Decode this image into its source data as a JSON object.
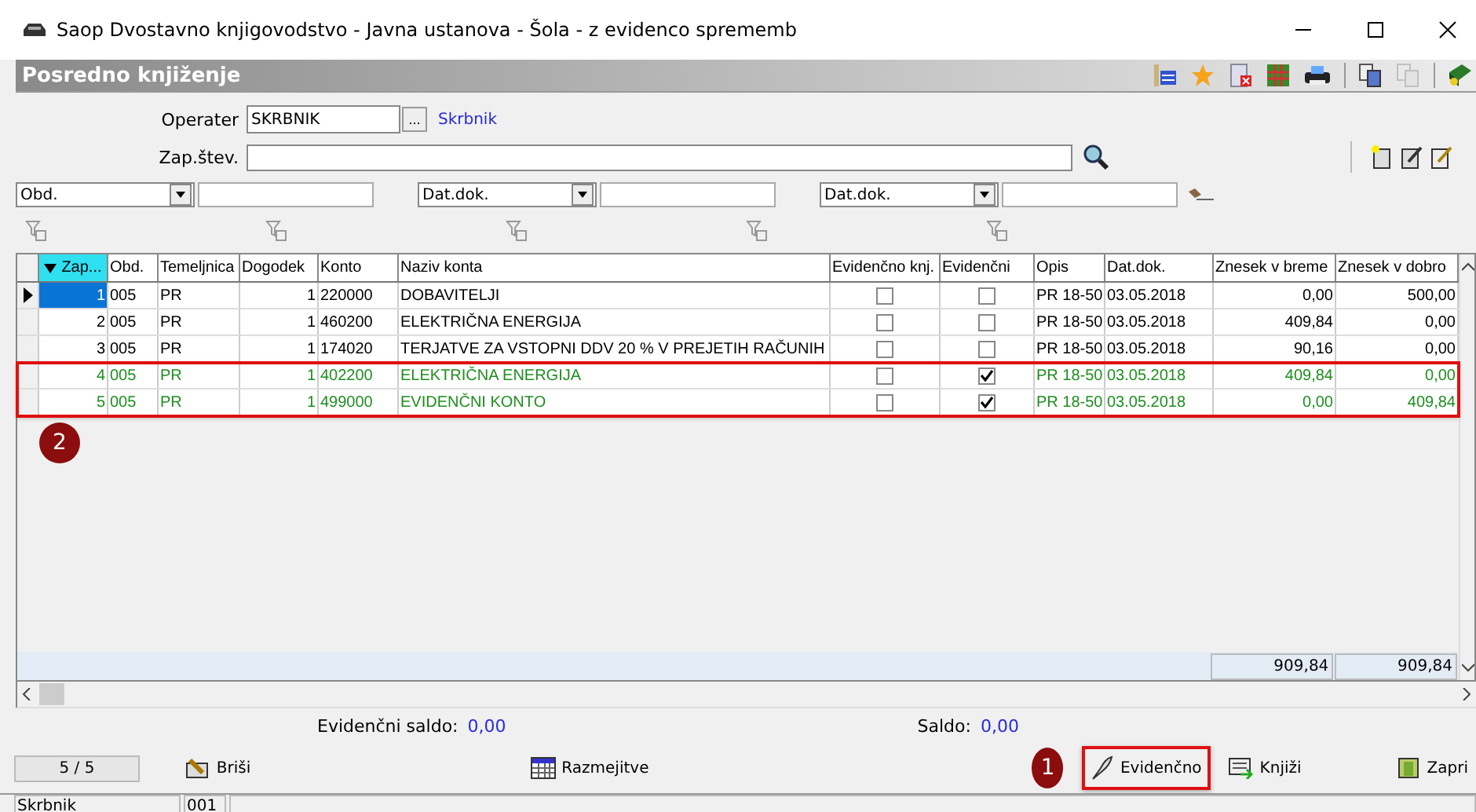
{
  "window": {
    "title": "Saop Dvostavno knjigovodstvo - Javna ustanova - Šola - z evidenco sprememb"
  },
  "panel": {
    "title": "Posredno knjiženje"
  },
  "form": {
    "operater": {
      "label": "Operater",
      "value": "SKRBNIK",
      "browse": "...",
      "name": "Skrbnik"
    },
    "zap_stev": {
      "label": "Zap.štev."
    }
  },
  "filters": [
    {
      "field": "Obd."
    },
    {
      "field": "Dat.dok."
    },
    {
      "field": "Dat.dok."
    }
  ],
  "table": {
    "columns": [
      "Zap...",
      "Obd.",
      "Temeljnica",
      "Dogodek",
      "Konto",
      "Naziv konta",
      "Evidenčno knj.",
      "Evidenčni",
      "Opis",
      "Dat.dok.",
      "Znesek v breme",
      "Znesek v dobro"
    ],
    "rows": [
      {
        "zap": "1",
        "obd": "005",
        "temeljnica": "PR",
        "dogodek": "1",
        "konto": "220000",
        "naziv": "DOBAVITELJI",
        "evidencno_knj": false,
        "evidencni": false,
        "opis": "PR 18-50",
        "dat_dok": "03.05.2018",
        "breme": "0,00",
        "dobro": "500,00",
        "selected": true,
        "highlighted": false
      },
      {
        "zap": "2",
        "obd": "005",
        "temeljnica": "PR",
        "dogodek": "1",
        "konto": "460200",
        "naziv": "ELEKTRIČNA ENERGIJA",
        "evidencno_knj": false,
        "evidencni": false,
        "opis": "PR 18-50",
        "dat_dok": "03.05.2018",
        "breme": "409,84",
        "dobro": "0,00",
        "selected": false,
        "highlighted": false
      },
      {
        "zap": "3",
        "obd": "005",
        "temeljnica": "PR",
        "dogodek": "1",
        "konto": "174020",
        "naziv": "TERJATVE ZA VSTOPNI DDV 20 % V PREJETIH RAČUNIH",
        "evidencno_knj": false,
        "evidencni": false,
        "opis": "PR 18-50",
        "dat_dok": "03.05.2018",
        "breme": "90,16",
        "dobro": "0,00",
        "selected": false,
        "highlighted": false
      },
      {
        "zap": "4",
        "obd": "005",
        "temeljnica": "PR",
        "dogodek": "1",
        "konto": "402200",
        "naziv": "ELEKTRIČNA ENERGIJA",
        "evidencno_knj": false,
        "evidencni": true,
        "opis": "PR 18-50",
        "dat_dok": "03.05.2018",
        "breme": "409,84",
        "dobro": "0,00",
        "selected": false,
        "highlighted": true
      },
      {
        "zap": "5",
        "obd": "005",
        "temeljnica": "PR",
        "dogodek": "1",
        "konto": "499000",
        "naziv": "EVIDENČNI KONTO",
        "evidencno_knj": false,
        "evidencni": true,
        "opis": "PR 18-50",
        "dat_dok": "03.05.2018",
        "breme": "0,00",
        "dobro": "409,84",
        "selected": false,
        "highlighted": true
      }
    ],
    "totals": [
      "909,84",
      "909,84"
    ]
  },
  "summary": [
    {
      "label": "Evidenčni saldo:",
      "value": "0,00"
    },
    {
      "label": "Saldo:",
      "value": "0,00"
    }
  ],
  "record_counter": "5 / 5",
  "buttons": [
    {
      "kind": "delete",
      "label": "Briši",
      "highlighted": false
    },
    {
      "kind": "calendar",
      "label": "Razmejitve",
      "highlighted": false
    },
    {
      "kind": "evidence",
      "label": "Evidenčno",
      "highlighted": true,
      "badge": "1"
    },
    {
      "kind": "post",
      "label": "Knjiži",
      "highlighted": false
    },
    {
      "kind": "close",
      "label": "Zapri",
      "highlighted": false
    }
  ],
  "grid_badge": "2",
  "status_bar": [
    "Skrbnik",
    "001"
  ]
}
